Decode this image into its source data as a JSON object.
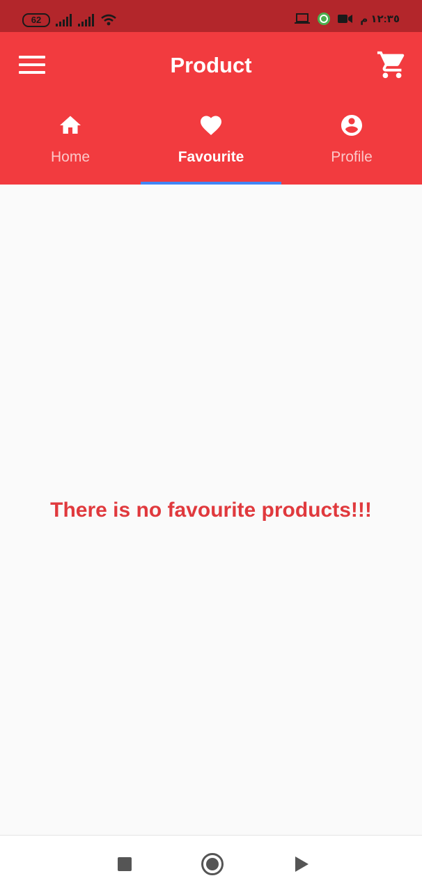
{
  "status_bar": {
    "battery": "62",
    "time": "١٢:٣٥ م"
  },
  "app_bar": {
    "title": "Product"
  },
  "tabs": [
    {
      "label": "Home",
      "icon": "home-icon",
      "active": false
    },
    {
      "label": "Favourite",
      "icon": "heart-icon",
      "active": true
    },
    {
      "label": "Profile",
      "icon": "account-circle-icon",
      "active": false
    }
  ],
  "content": {
    "empty_message": "There is no favourite products!!!"
  },
  "colors": {
    "status_bar": "#b3262b",
    "primary": "#f23b3f",
    "tab_indicator": "#4285f4",
    "message": "#e0393d"
  }
}
